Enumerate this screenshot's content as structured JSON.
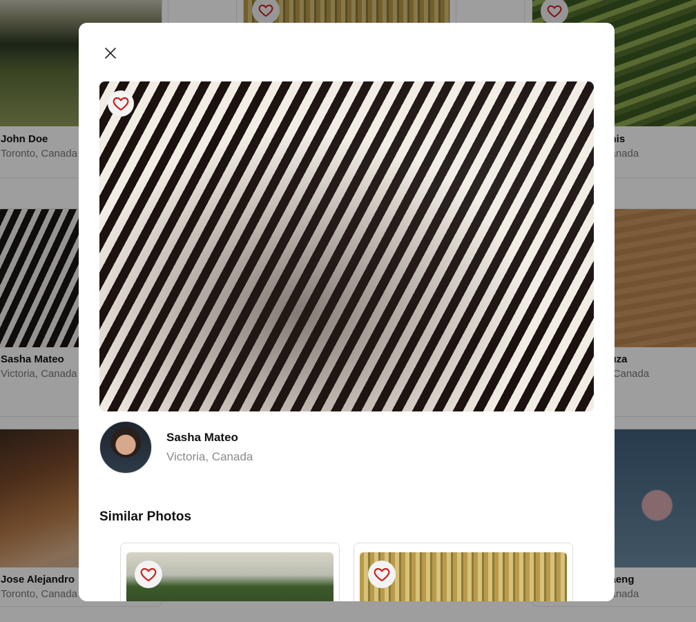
{
  "gallery": {
    "cards": [
      {
        "name": "John Doe",
        "location": "Toronto, Canada"
      },
      {
        "name": "Sasha Mateo",
        "location": "Victoria, Canada"
      },
      {
        "name": "Jose Alejandro",
        "location": "Toronto, Canada"
      },
      {
        "name": "...nis",
        "location": "...anada"
      },
      {
        "name": "...uza",
        "location": "... Canada"
      },
      {
        "name": "...aeng",
        "location": "...anada"
      }
    ]
  },
  "modal": {
    "close_icon": "close-icon",
    "heart_icon": "heart-icon",
    "author": {
      "name": "Sasha Mateo",
      "location": "Victoria, Canada"
    },
    "similar_title": "Similar Photos"
  },
  "colors": {
    "heart": "#cc1f1f",
    "overlay": "rgba(0,0,0,0.38)"
  }
}
